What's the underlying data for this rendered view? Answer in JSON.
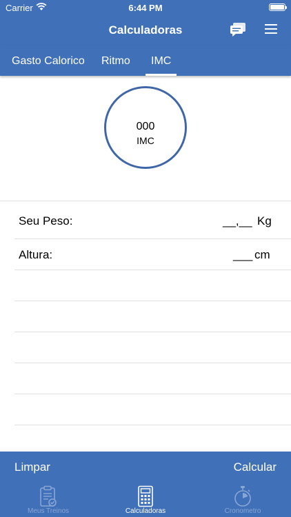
{
  "status_bar": {
    "carrier": "Carrier",
    "time": "6:44 PM",
    "battery_level": 1.0
  },
  "header": {
    "title": "Calculadoras",
    "icons": [
      "chat-icon",
      "menu-icon"
    ]
  },
  "tabs": [
    {
      "label": "Gasto Calorico",
      "selected": false
    },
    {
      "label": "Ritmo",
      "selected": false
    },
    {
      "label": "IMC",
      "selected": true
    }
  ],
  "gauge": {
    "value": "000",
    "label": "IMC"
  },
  "form": {
    "weight": {
      "label": "Seu Peso:",
      "value": "__,__",
      "unit": "Kg"
    },
    "height": {
      "label": "Altura:",
      "value": "___",
      "unit": "cm"
    }
  },
  "actions": {
    "clear_label": "Limpar",
    "calculate_label": "Calcular"
  },
  "tabbar": [
    {
      "label": "Meus Treinos",
      "icon": "clipboard-check-icon",
      "active": false
    },
    {
      "label": "Calculadoras",
      "icon": "calculator-icon",
      "active": true
    },
    {
      "label": "Cronometro",
      "icon": "stopwatch-icon",
      "active": false
    }
  ],
  "colors": {
    "primary": "#4070b8",
    "gauge_ring": "#3f67a8",
    "inactive_tab": "#8aa6d6"
  }
}
